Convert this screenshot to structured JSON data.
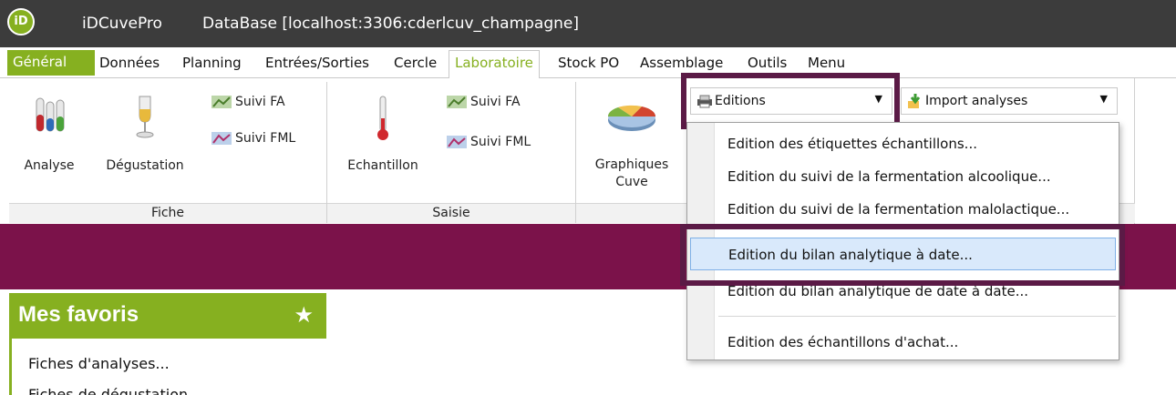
{
  "titlebar": {
    "logo": "iD",
    "app_name": "iDCuvePro",
    "db_title": "DataBase [localhost:3306:cderlcuv_champagne]"
  },
  "menu": {
    "general": "Général",
    "tabs": [
      "Données",
      "Planning",
      "Entrées/Sorties",
      "Cercle",
      "Laboratoire",
      "Stock PO",
      "Assemblage",
      "Outils",
      "Menu"
    ],
    "active": "Laboratoire"
  },
  "ribbon": {
    "groups": {
      "fiche": {
        "label": "Fiche",
        "analyse": "Analyse",
        "degustation": "Dégustation",
        "suivi_fa": "Suivi FA",
        "suivi_fml": "Suivi FML"
      },
      "saisie": {
        "label": "Saisie",
        "echantillon": "Echantillon",
        "suivi_fa": "Suivi FA",
        "suivi_fml": "Suivi FML"
      },
      "graph": {
        "label_line1": "Graphiques",
        "label_line2": "Cuve"
      }
    },
    "editions_label": "Editions",
    "import_label": "Import analyses"
  },
  "popup": {
    "items": [
      "Edition des étiquettes échantillons...",
      "Edition du suivi de la fermentation alcoolique...",
      "Edition du suivi de la fermentation malolactique...",
      "Edition du bilan analytique à date...",
      "Edition du bilan analytique de date à date...",
      "Edition des échantillons d'achat..."
    ],
    "highlighted_index": 3
  },
  "favorites": {
    "title": "Mes favoris",
    "star": "★",
    "items": [
      "Fiches d'analyses...",
      "Fiches de dégustation..."
    ]
  },
  "colors": {
    "titlebar": "#3c3c3c",
    "brand_green": "#86b020",
    "band_purple": "#7b124a",
    "highlight_box": "#5b1a46",
    "menu_hover": "#d9e9fb"
  }
}
